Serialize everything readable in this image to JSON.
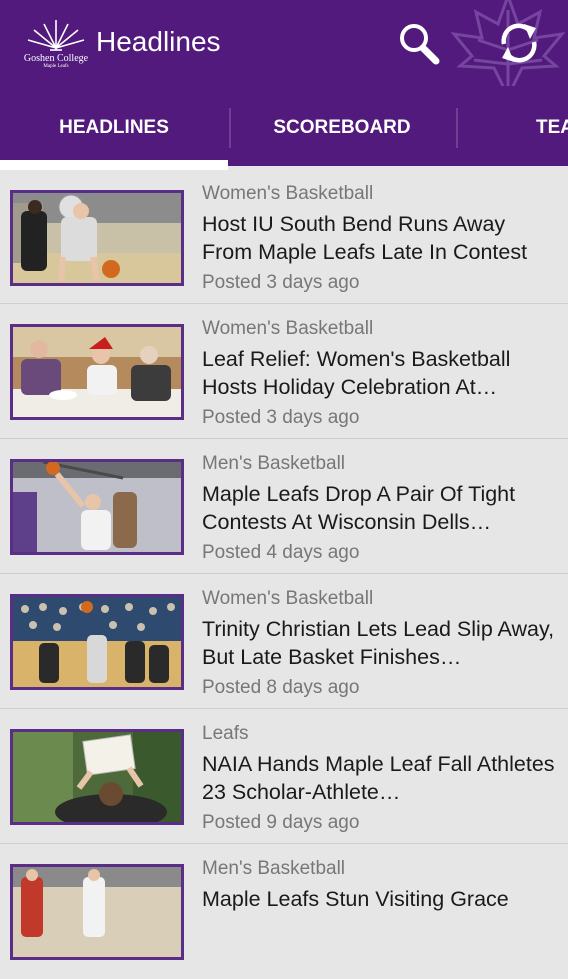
{
  "app": {
    "title": "Headlines",
    "logo_text": "Goshen College",
    "logo_subtext": "Maple Leafs"
  },
  "icons": {
    "logo": "goshen-college-logo",
    "search": "search-icon",
    "refresh": "refresh-icon",
    "watermark": "maple-leaf-icon"
  },
  "colors": {
    "brand": "#511a7c",
    "background": "#e6e6e6",
    "thumb_border": "#5a2d86"
  },
  "tabs": [
    {
      "label": "HEADLINES",
      "selected": true
    },
    {
      "label": "SCOREBOARD",
      "selected": false
    },
    {
      "label": "TEAMS",
      "selected": false
    }
  ],
  "articles": [
    {
      "category": "Women's Basketball",
      "title": "Host IU South Bend Runs Away From Maple Leafs Late In Contest",
      "posted": "Posted 3 days ago"
    },
    {
      "category": "Women's Basketball",
      "title": "Leaf Relief: Women's Basketball Hosts Holiday Celebration At…",
      "posted": "Posted 3 days ago"
    },
    {
      "category": "Men's Basketball",
      "title": "Maple Leafs Drop A Pair Of Tight Contests At Wisconsin Dells…",
      "posted": "Posted 4 days ago"
    },
    {
      "category": "Women's Basketball",
      "title": "Trinity Christian Lets Lead Slip Away, But Late Basket Finishes…",
      "posted": "Posted 8 days ago"
    },
    {
      "category": "Leafs",
      "title": "NAIA Hands Maple Leaf Fall Athletes 23 Scholar-Athlete…",
      "posted": "Posted 9 days ago"
    },
    {
      "category": "Men's Basketball",
      "title": "Maple Leafs Stun Visiting Grace",
      "posted": ""
    }
  ]
}
